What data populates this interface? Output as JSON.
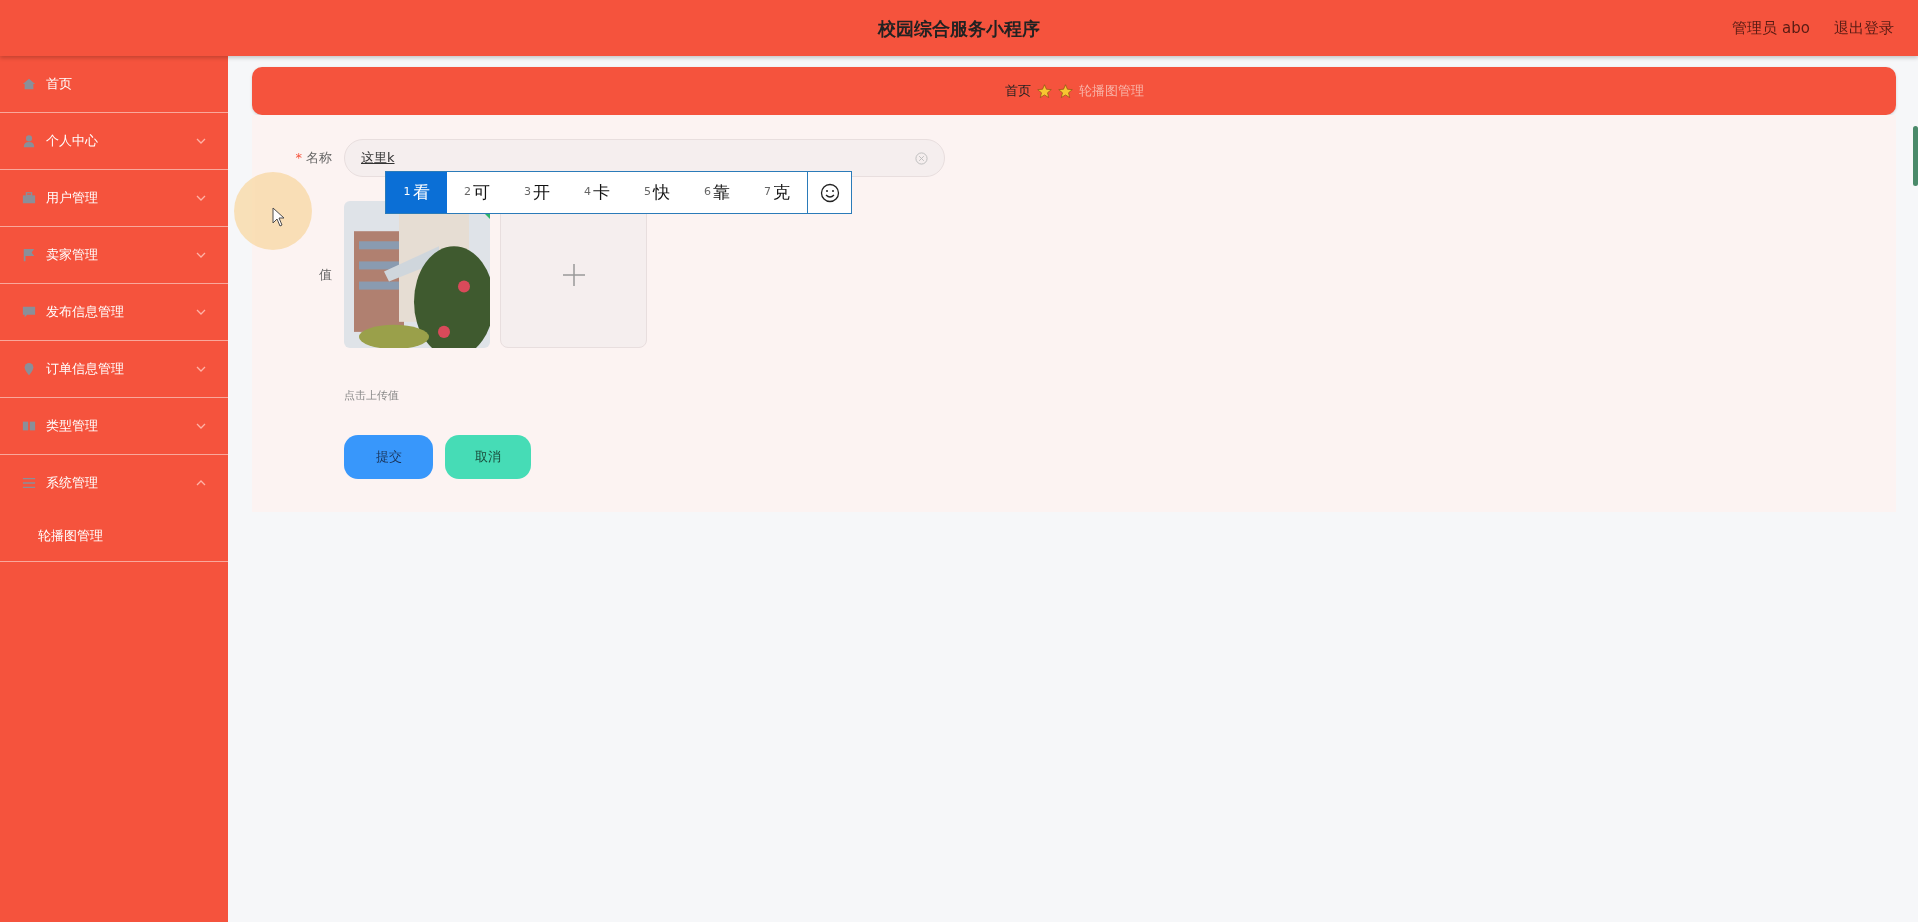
{
  "header": {
    "title": "校园综合服务小程序",
    "user": "管理员 abo",
    "logout": "退出登录"
  },
  "sidebar": {
    "items": [
      {
        "label": "首页",
        "kind": "link"
      },
      {
        "label": "个人中心",
        "kind": "menu",
        "expanded": false
      },
      {
        "label": "用户管理",
        "kind": "menu",
        "expanded": false
      },
      {
        "label": "卖家管理",
        "kind": "menu",
        "expanded": false
      },
      {
        "label": "发布信息管理",
        "kind": "menu",
        "expanded": false
      },
      {
        "label": "订单信息管理",
        "kind": "menu",
        "expanded": false
      },
      {
        "label": "类型管理",
        "kind": "menu",
        "expanded": false
      },
      {
        "label": "系统管理",
        "kind": "menu",
        "expanded": true,
        "children": [
          {
            "label": "轮播图管理"
          }
        ]
      }
    ]
  },
  "breadcrumb": {
    "home": "首页",
    "current": "轮播图管理"
  },
  "form": {
    "required_mark": "*",
    "name_label": "名称",
    "name_value": "这里k",
    "value_label": "值",
    "upload_hint": "点击上传值"
  },
  "ime": {
    "candidates": [
      {
        "index": "1",
        "text": "看",
        "selected": true
      },
      {
        "index": "2",
        "text": "可",
        "selected": false
      },
      {
        "index": "3",
        "text": "开",
        "selected": false
      },
      {
        "index": "4",
        "text": "卡",
        "selected": false
      },
      {
        "index": "5",
        "text": "快",
        "selected": false
      },
      {
        "index": "6",
        "text": "靠",
        "selected": false
      },
      {
        "index": "7",
        "text": "克",
        "selected": false
      }
    ]
  },
  "buttons": [
    {
      "label": "提交",
      "kind": "primary"
    },
    {
      "label": "取消",
      "kind": "secondary"
    }
  ]
}
